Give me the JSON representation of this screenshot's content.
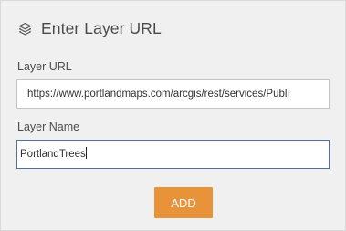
{
  "header": {
    "icon": "layers-icon",
    "title": "Enter Layer URL"
  },
  "form": {
    "url_label": "Layer URL",
    "url_value": "https://www.portlandmaps.com/arcgis/rest/services/Publi",
    "name_label": "Layer Name",
    "name_value": "PortlandTrees",
    "add_label": "ADD"
  },
  "colors": {
    "panel_background": "#f0f0f0",
    "active_border": "#4f70a1",
    "accent_button": "#e8923a"
  }
}
